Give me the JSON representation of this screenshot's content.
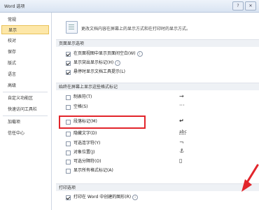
{
  "window": {
    "title": "Word 选项",
    "controls": [
      "?",
      "✕"
    ]
  },
  "sidebar": {
    "items": [
      {
        "label": "常规",
        "active": false
      },
      {
        "label": "显示",
        "active": true
      },
      {
        "label": "校对",
        "active": false
      },
      {
        "label": "保存",
        "active": false
      },
      {
        "label": "版式",
        "active": false
      },
      {
        "label": "语言",
        "active": false
      },
      {
        "label": "高级",
        "active": false
      },
      {
        "label": "自定义功能区",
        "active": false
      },
      {
        "label": "快速访问工具栏",
        "active": false
      },
      {
        "label": "加载项",
        "active": false
      },
      {
        "label": "信任中心",
        "active": false
      }
    ]
  },
  "main": {
    "intro": "更改文档内容在屏幕上的显示方式和在打印时的显示方式。",
    "page_section": {
      "heading": "页面显示选项",
      "options": [
        {
          "label": "在页面视图中显示页面间空白(W)",
          "checked": true
        },
        {
          "label": "显示突出显示标记(H)",
          "checked": true
        },
        {
          "label": "悬停时显示文档工具提示(L)",
          "checked": true
        }
      ]
    },
    "marks_section": {
      "heading": "始终在屏幕上显示这些格式标记",
      "options": [
        {
          "label": "制表符(T)",
          "checked": false,
          "glyph": "→"
        },
        {
          "label": "空格(S)",
          "checked": false,
          "glyph": "···"
        },
        {
          "label": "段落标记(M)",
          "checked": false,
          "glyph": "↵"
        },
        {
          "label": "隐藏文字(D)",
          "checked": false,
          "glyph": "abc"
        },
        {
          "label": "可选连字符(Y)",
          "checked": false,
          "glyph": "¬"
        },
        {
          "label": "对象位置(J)",
          "checked": false,
          "glyph": "⚓"
        },
        {
          "label": "可选分隔符(O)",
          "checked": false,
          "glyph": "▯"
        },
        {
          "label": "显示所有格式标记(A)",
          "checked": false,
          "glyph": ""
        }
      ]
    },
    "print_section": {
      "heading": "打印选项",
      "options": [
        {
          "label": "打印在 Word 中创建的图形(R)",
          "checked": true
        }
      ]
    }
  },
  "colors": {
    "highlight": "#e2252b",
    "active_sidebar": "#fde7a8"
  }
}
